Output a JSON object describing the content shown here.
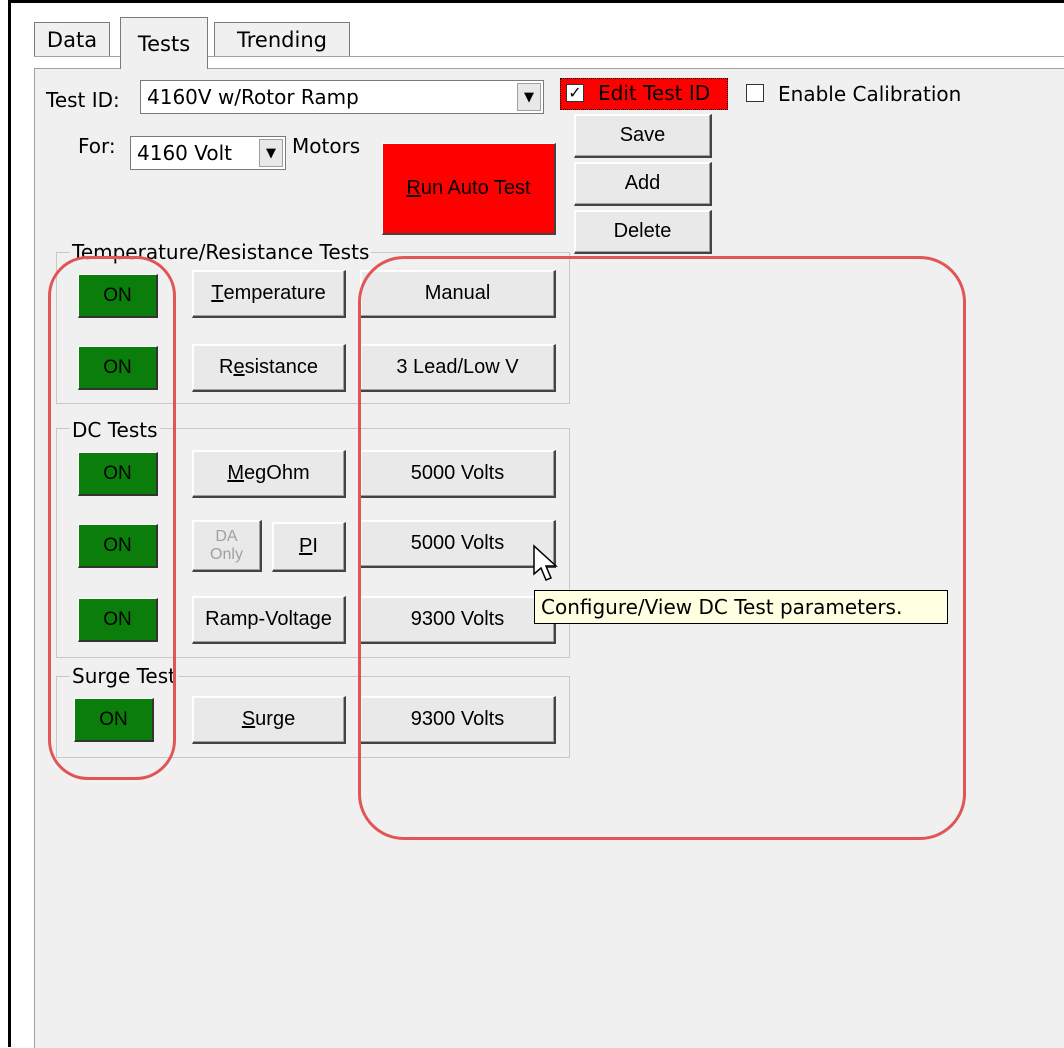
{
  "tabs": [
    "Data",
    "Tests",
    "Trending"
  ],
  "active_tab": "Tests",
  "test_id": {
    "label": "Test ID:",
    "value": "4160V w/Rotor Ramp"
  },
  "for_field": {
    "label": "For:",
    "value": "4160 Volt",
    "suffix": "Motors"
  },
  "edit_test_id": {
    "label": "Edit Test ID",
    "checked": true
  },
  "enable_calibration": {
    "label": "Enable Calibration",
    "checked": false
  },
  "actions": {
    "save": "Save",
    "add": "Add",
    "delete": "Delete"
  },
  "run_auto_test": {
    "prefix": "R",
    "rest": "un Auto Test"
  },
  "groups": {
    "temp": {
      "title": "Temperature/Resistance Tests",
      "rows": [
        {
          "status": "ON",
          "test_u": "T",
          "test_rest": "emperature",
          "config": "Manual"
        },
        {
          "status": "ON",
          "test_pre": "R",
          "test_u": "e",
          "test_rest": "sistance",
          "config": "3 Lead/Low V"
        }
      ]
    },
    "dc": {
      "title": "DC Tests",
      "rows": [
        {
          "status": "ON",
          "test_u": "M",
          "test_rest": "egOhm",
          "config": "5000 Volts"
        },
        {
          "status": "ON",
          "da_line1": "DA",
          "da_line2": "Only",
          "pi_u": "P",
          "pi_rest": "I",
          "config": "5000 Volts"
        },
        {
          "status": "ON",
          "test": "Ramp-Voltage",
          "config": "9300 Volts"
        }
      ]
    },
    "surge": {
      "title": "Surge Test",
      "rows": [
        {
          "status": "ON",
          "test_u": "S",
          "test_rest": "urge",
          "config": "9300 Volts"
        }
      ]
    }
  },
  "tooltip": "Configure/View DC Test parameters.",
  "colors": {
    "on_green": "#0b7d0b",
    "run_red": "#ff0000",
    "highlight": "#e05555",
    "tooltip_bg": "#ffffe1"
  }
}
